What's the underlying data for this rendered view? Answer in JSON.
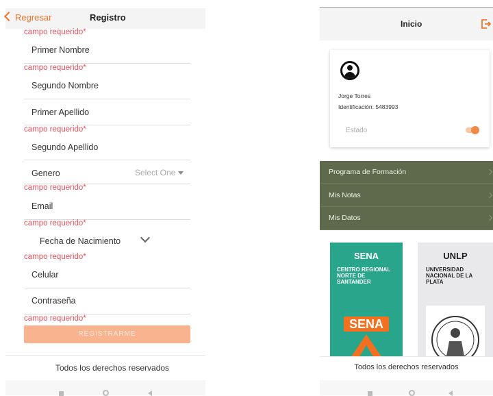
{
  "register": {
    "back_label": "Regresar",
    "title": "Registro",
    "required_text": "campo requerido*",
    "fields": {
      "primer_nombre": "Primer Nombre",
      "segundo_nombre": "Segundo Nombre",
      "primer_apellido": "Primer Apellido",
      "segundo_apellido": "Segundo Apellido",
      "genero": "Genero",
      "genero_select": "Select One",
      "email": "Email",
      "fecha_nacimiento": "Fecha de Nacimiento",
      "celular": "Celular",
      "contrasena": "Contraseña"
    },
    "submit_label": "REGISTRARME",
    "footer": "Todos los derechos reservados"
  },
  "home": {
    "title": "Inicio",
    "profile": {
      "name": "Jorge Torres",
      "identification": "Identificación: 5483993",
      "status_label": "Estado"
    },
    "menu": [
      {
        "label": "Programa de Formación"
      },
      {
        "label": "Mis Notas"
      },
      {
        "label": "Mis Datos"
      }
    ],
    "institutions": {
      "sena": {
        "title": "SENA",
        "subtitle": "CENTRO REGIONAL NORTE DE SANTANDER",
        "logo_text": "SENA"
      },
      "unlp": {
        "title": "UNLP",
        "subtitle": "UNIVERSIDAD NACIONAL DE LA PLATA"
      }
    },
    "footer": "Todos los derechos reservados"
  },
  "colors": {
    "accent": "#f0752c",
    "required": "#e8505b",
    "menu_bg": "#5f6a4d",
    "sena_bg": "#28a58a",
    "button_bg": "#f9b48f"
  }
}
